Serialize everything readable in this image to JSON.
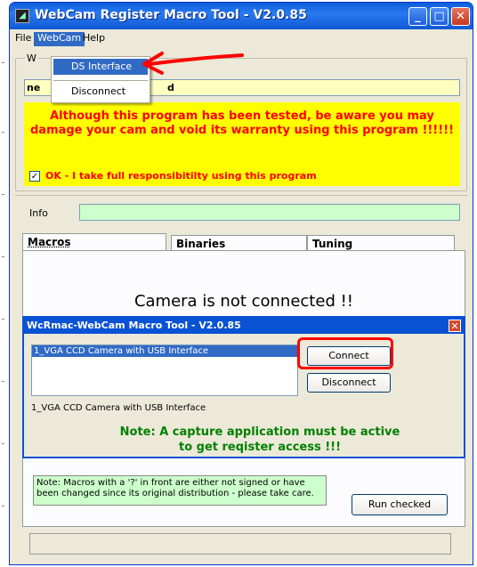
{
  "window": {
    "title": "WebCam Register Macro Tool - V2.0.85",
    "controls": {
      "minimize": "_",
      "maximize": "□",
      "close": "✕"
    }
  },
  "menubar": {
    "items": [
      {
        "label": "File"
      },
      {
        "label": "WebCam"
      },
      {
        "label": "Help"
      }
    ]
  },
  "webcam_menu": {
    "items": [
      {
        "label": "DS Interface"
      },
      {
        "label": "Disconnect"
      }
    ]
  },
  "top_group": {
    "caption_fragment": "W",
    "field_value_left": "ne",
    "field_value_right": "d"
  },
  "warning": {
    "text": "Although this program has been tested, be aware you may damage your cam and void its warranty using this program !!!!!!",
    "checkbox_checked": true,
    "checkbox_mark": "✓",
    "checkbox_label": "OK - I take full responsibitilty using this program"
  },
  "info": {
    "label": "Info",
    "value": ""
  },
  "tabs": [
    {
      "label": "Macros"
    },
    {
      "label": "Binaries"
    },
    {
      "label": "Tuning"
    }
  ],
  "status_message": "Camera is not connected !!",
  "dialog": {
    "title": "WcRmac-WebCam Macro Tool - V2.0.85",
    "close": "✕",
    "devices": [
      "1_VGA CCD Camera with USB Interface"
    ],
    "selected_device_label": "1_VGA CCD Camera with USB Interface",
    "connect_label": "Connect",
    "disconnect_label": "Disconnect",
    "note": "Note:  A capture application must be active to get reqister access !!!"
  },
  "macro_note": "Note: Macros with a '?' in front are either not signed or have been changed since its original distribution - please take care.",
  "run_checked_label": "Run checked",
  "colors": {
    "warning_bg": "#ffff00",
    "warning_text": "#ff0000",
    "info_bg": "#ccffcc",
    "highlight": "#316ac5",
    "annotation": "#ff0000",
    "dialog_note": "#008000"
  }
}
